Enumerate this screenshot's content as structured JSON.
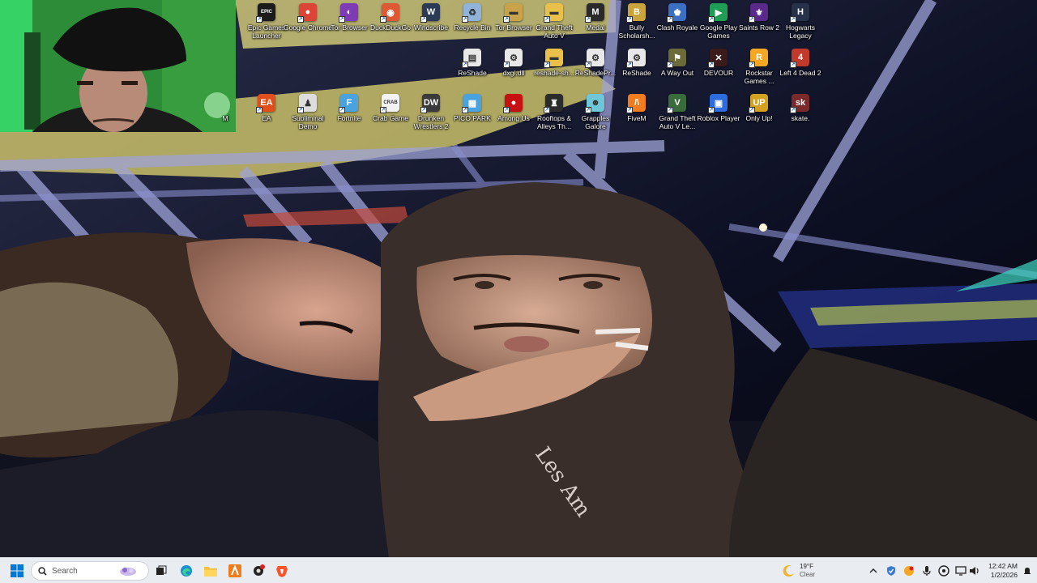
{
  "desktop": {
    "icons": [
      {
        "label": "Epic Games Launcher",
        "glyph": "EPIC",
        "color": "#1b1b1b"
      },
      {
        "label": "Google Chrome",
        "glyph": "●",
        "color": "#db4437"
      },
      {
        "label": "Tor Browser",
        "glyph": "◐",
        "color": "#7d3cb5"
      },
      {
        "label": "DuckDuckGo",
        "glyph": "◉",
        "color": "#de5833"
      },
      {
        "label": "Windscribe",
        "glyph": "W",
        "color": "#2b3a55"
      },
      {
        "label": "Recycle Bin",
        "glyph": "♻",
        "color": "#8fb3d9"
      },
      {
        "label": "Tor Browser",
        "glyph": "▬",
        "color": "#c9a24a"
      },
      {
        "label": "Grand Theft Auto V",
        "glyph": "▬",
        "color": "#e8c04a"
      },
      {
        "label": "Medal",
        "glyph": "M",
        "color": "#2a2a2a"
      },
      {
        "label": "Bully Scholarsh...",
        "glyph": "B",
        "color": "#caa43a"
      },
      {
        "label": "Clash Royale",
        "glyph": "♚",
        "color": "#3b6fc4"
      },
      {
        "label": "Google Play Games",
        "glyph": "▶",
        "color": "#1f9d55"
      },
      {
        "label": "Saints Row 2",
        "glyph": "⚜",
        "color": "#5a2a8a"
      },
      {
        "label": "Hogwarts Legacy",
        "glyph": "H",
        "color": "#27324a"
      },
      {
        "label": "ReShade",
        "glyph": "▤",
        "color": "#e8e8e8"
      },
      {
        "label": "dxgi.dll",
        "glyph": "⚙",
        "color": "#e8e8e8"
      },
      {
        "label": "reshade-sh...",
        "glyph": "▬",
        "color": "#e8c04a"
      },
      {
        "label": "ReShadePr...",
        "glyph": "⚙",
        "color": "#e8e8e8"
      },
      {
        "label": "ReShade",
        "glyph": "⚙",
        "color": "#e8e8e8"
      },
      {
        "label": "A Way Out",
        "glyph": "⚑",
        "color": "#6b6b3a"
      },
      {
        "label": "DEVOUR",
        "glyph": "✕",
        "color": "#3a1a1a"
      },
      {
        "label": "Rockstar Games ...",
        "glyph": "R",
        "color": "#f5a623"
      },
      {
        "label": "Left 4 Dead 2",
        "glyph": "4",
        "color": "#c0392b"
      },
      {
        "label": "M",
        "glyph": "",
        "color": "#00000000"
      },
      {
        "label": "EA",
        "glyph": "EA",
        "color": "#e04e1b"
      },
      {
        "label": "Subliminal Demo",
        "glyph": "♟",
        "color": "#dddddd"
      },
      {
        "label": "Fortnite",
        "glyph": "F",
        "color": "#4aa3df"
      },
      {
        "label": "Crab Game",
        "glyph": "CRAB",
        "color": "#f2f2f2"
      },
      {
        "label": "Drunken Wrestlers 2",
        "glyph": "DW",
        "color": "#3a3a3a"
      },
      {
        "label": "PICO PARK",
        "glyph": "▦",
        "color": "#4aa3df"
      },
      {
        "label": "Among Us",
        "glyph": "●",
        "color": "#c51111"
      },
      {
        "label": "Rooftops & Alleys Th...",
        "glyph": "♜",
        "color": "#2b2b2b"
      },
      {
        "label": "Grapples Galore",
        "glyph": "☻",
        "color": "#6ec6d6"
      },
      {
        "label": "FiveM",
        "glyph": "/\\",
        "color": "#f07c1e"
      },
      {
        "label": "Grand Theft Auto V Le...",
        "glyph": "V",
        "color": "#3a6b3a"
      },
      {
        "label": "Roblox Player",
        "glyph": "▣",
        "color": "#2d6cdf"
      },
      {
        "label": "Only Up!",
        "glyph": "UP",
        "color": "#d4a020"
      },
      {
        "label": "skate.",
        "glyph": "sk",
        "color": "#7a2a2a"
      }
    ]
  },
  "taskbar": {
    "search_placeholder": "Search",
    "weather_temp": "19°F",
    "weather_condition": "Clear",
    "clock_time": "12:42 AM",
    "clock_date": "1/2/2026",
    "colors": {
      "accent": "#0078d4",
      "brave": "#fb542b"
    }
  }
}
